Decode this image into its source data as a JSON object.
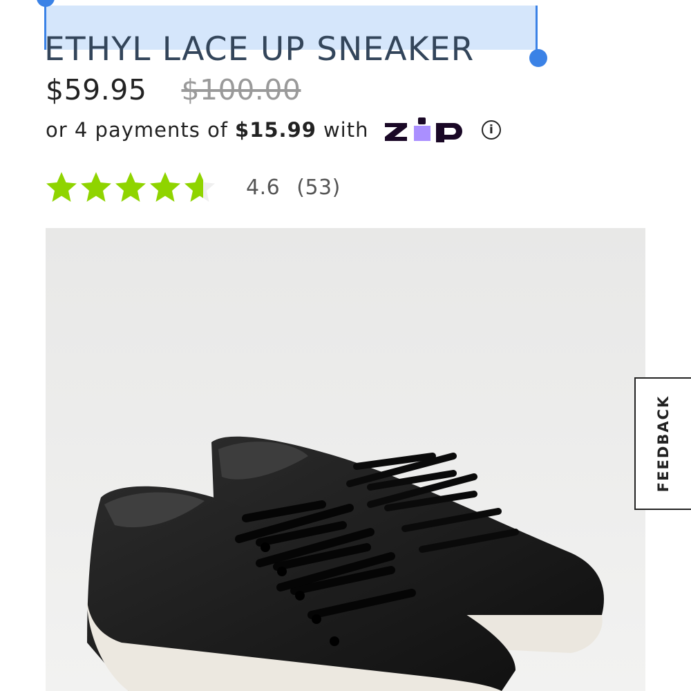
{
  "product": {
    "title": "ETHYL LACE UP SNEAKER",
    "price": "$59.95",
    "original_price": "$100.00",
    "installments": {
      "prefix": "or 4 payments of",
      "amount": "$15.99",
      "suffix": "with",
      "provider": "ZIP",
      "info_icon": "info-icon"
    },
    "rating": {
      "value": "4.6",
      "count": "(53)",
      "stars_filled": 4.6,
      "stars_total": 5,
      "star_color": "#8fd400"
    },
    "image": {
      "description_icon": "product-photo",
      "background": "#e9e9e8"
    }
  },
  "feedback": {
    "label": "FEEDBACK"
  },
  "colors": {
    "selection": "#d5e6fb",
    "selection_handle": "#3b82e6",
    "zip_purple": "#aa8fff",
    "zip_dark": "#1a0826"
  }
}
